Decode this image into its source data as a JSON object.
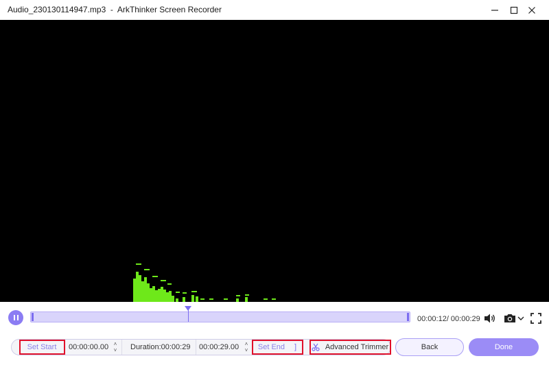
{
  "window": {
    "file_name": "Audio_230130114947.mp3",
    "separator": "  -  ",
    "app_name": "ArkThinker Screen Recorder"
  },
  "player": {
    "time_readout": "00:00:12/ 00:00:29"
  },
  "editor": {
    "set_start_label": "Set Start",
    "start_time": "00:00:00.00",
    "duration_label": "Duration:00:00:29",
    "end_time": "00:00:29.00",
    "set_end_label": "Set End",
    "set_end_bracket": "]",
    "advanced_trimmer_label": "Advanced Trimmer",
    "back_label": "Back",
    "done_label": "Done",
    "stepper_up": "˄",
    "stepper_down": "˅"
  },
  "colors": {
    "accent": "#8b7cf3",
    "visualizer": "#6ee81a",
    "highlight_box": "#e0102a"
  },
  "icons": [
    "minimize-icon",
    "maximize-icon",
    "close-icon",
    "pause-icon",
    "volume-icon",
    "camera-icon",
    "chevron-down-icon",
    "fullscreen-icon",
    "trimmer-icon"
  ]
}
